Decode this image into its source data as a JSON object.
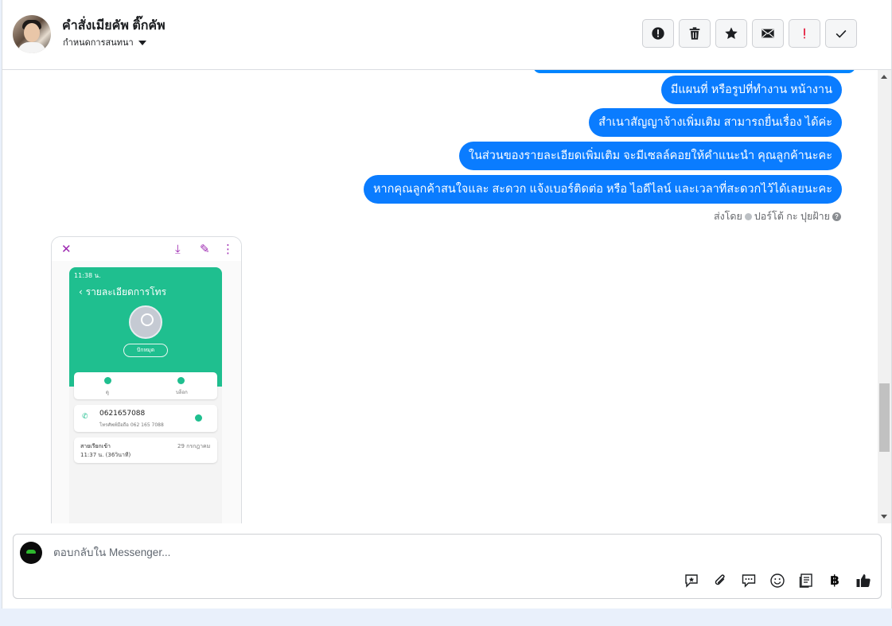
{
  "header": {
    "contact_name": "คำสั่งเมียคัพ ติ๊กคัพ",
    "assign_label": "กำหนดการสนทนา",
    "actions": [
      {
        "name": "spam-icon",
        "label": "spam"
      },
      {
        "name": "trash-icon",
        "label": "delete"
      },
      {
        "name": "star-icon",
        "label": "star"
      },
      {
        "name": "envelope-icon",
        "label": "mark-unread"
      },
      {
        "name": "exclamation-icon",
        "label": "follow-up"
      },
      {
        "name": "check-icon",
        "label": "done"
      }
    ]
  },
  "messages": [
    {
      "text": "มีแผนที่ หรือรูปที่ทำงาน หน้างาน"
    },
    {
      "text": "สำเนาสัญญาจ้างเพิ่มเติม สามารถยื่นเรื่อง ได้ค่ะ"
    },
    {
      "text": "ในส่วนของรายละเอียดเพิ่มเติม จะมีเซลล์คอยให้คำแนะนำ คุณลูกค้านะคะ"
    },
    {
      "text": "หากคุณลูกค้าสนใจและ สะดวก แจ้งเบอร์ติดต่อ หรือ ไอดีไลน์ และเวลาที่สะดวกไว้ได้เลยนะคะ"
    }
  ],
  "sent_by": {
    "prefix": "ส่งโดย",
    "sender": "ปอร์โต้ กะ ปุยฝ้าย",
    "help": "?"
  },
  "attachment": {
    "top_icons": {
      "close": "✕",
      "download": "⤓",
      "edit": "✎",
      "more": "⋮"
    },
    "phone": {
      "status_time": "11:38 น.",
      "title": "รายละเอียดการโทร",
      "chip": "ปักหมุด",
      "card_labels": {
        "left": "ดู",
        "right": "บล็อก"
      },
      "number": "0621657088",
      "number_sub": "โทรศัพท์มือถือ 062 165 7088",
      "call_type": "สายเรียกเข้า",
      "call_time": "11:37 น. (36วินาที)",
      "call_date": "29 กรกฎาคม"
    }
  },
  "composer": {
    "placeholder": "ตอบกลับใน Messenger...",
    "tools": [
      "saved-reply-icon",
      "attach-icon",
      "chat-bubble-icon",
      "emoji-icon",
      "template-icon",
      "baht-icon",
      "like-icon"
    ],
    "baht_symbol": "฿"
  }
}
